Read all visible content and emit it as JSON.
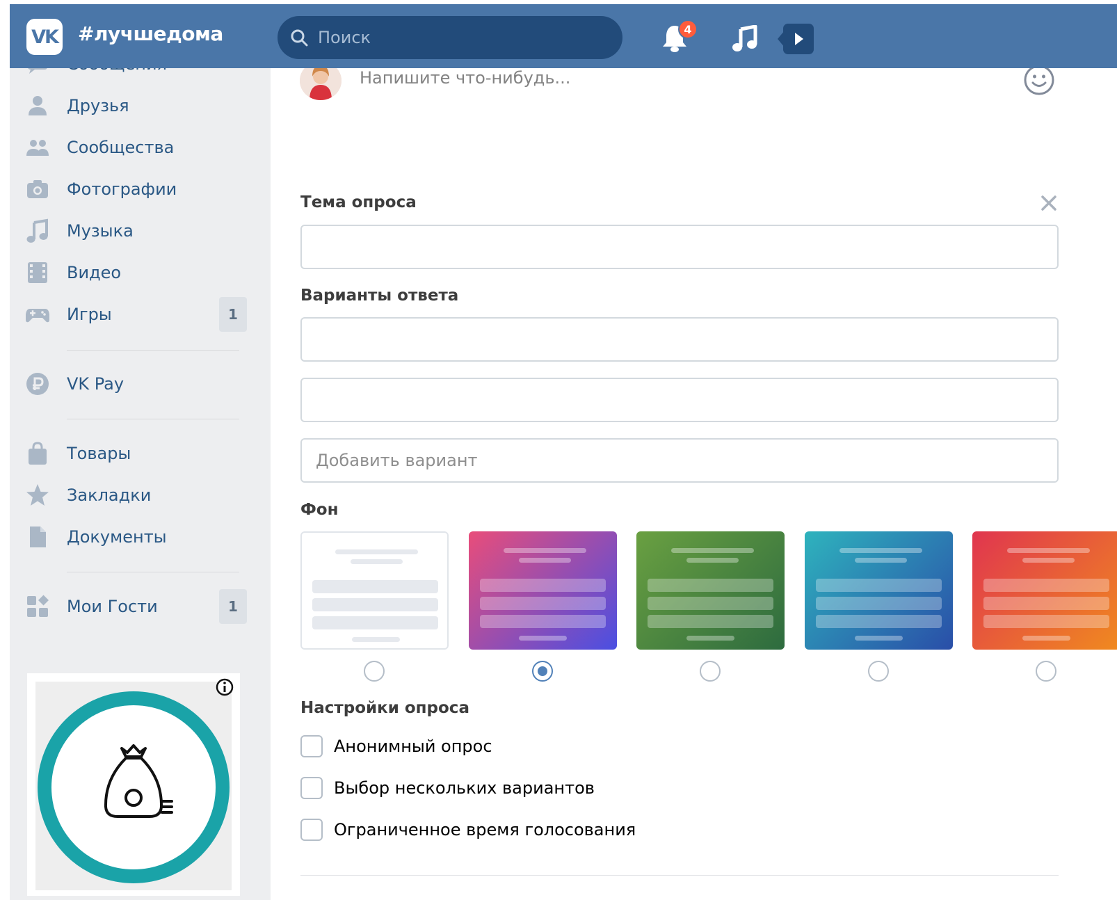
{
  "header": {
    "logo_text": "VK",
    "hashtag": "#лучшедома",
    "search_placeholder": "Поиск",
    "notifications_count": "4"
  },
  "sidebar": {
    "items": [
      {
        "label": "Сообщения",
        "icon": "message-icon"
      },
      {
        "label": "Друзья",
        "icon": "user-icon"
      },
      {
        "label": "Сообщества",
        "icon": "users-icon"
      },
      {
        "label": "Фотографии",
        "icon": "camera-icon"
      },
      {
        "label": "Музыка",
        "icon": "music-icon"
      },
      {
        "label": "Видео",
        "icon": "film-icon"
      },
      {
        "label": "Игры",
        "icon": "gamepad-icon",
        "count": "1"
      },
      {
        "label": "VK Pay",
        "icon": "ruble-icon"
      },
      {
        "label": "Товары",
        "icon": "bag-icon"
      },
      {
        "label": "Закладки",
        "icon": "star-icon"
      },
      {
        "label": "Документы",
        "icon": "document-icon"
      },
      {
        "label": "Мои Гости",
        "icon": "apps-icon",
        "count": "1"
      }
    ]
  },
  "composer": {
    "placeholder": "Напишите что-нибудь..."
  },
  "poll": {
    "topic_label": "Тема опроса",
    "topic_value": "",
    "answers_label": "Варианты ответа",
    "answers": [
      "",
      ""
    ],
    "add_option_placeholder": "Добавить вариант",
    "background_label": "Фон",
    "backgrounds": [
      {
        "name": "white",
        "colors": [
          "#ffffff",
          "#ffffff"
        ],
        "selected": false
      },
      {
        "name": "pink-purple",
        "colors": [
          "#e94d7a",
          "#4a4fe2"
        ],
        "selected": true
      },
      {
        "name": "green",
        "colors": [
          "#6aa041",
          "#2d6b3f"
        ],
        "selected": false
      },
      {
        "name": "teal-blue",
        "colors": [
          "#2eb3bd",
          "#2a4ea8"
        ],
        "selected": false
      },
      {
        "name": "red-orange",
        "colors": [
          "#e0354f",
          "#f08a1f"
        ],
        "selected": false
      }
    ],
    "settings_label": "Настройки опроса",
    "settings": [
      {
        "label": "Анонимный опрос",
        "checked": false
      },
      {
        "label": "Выбор нескольких вариантов",
        "checked": false
      },
      {
        "label": "Ограниченное время голосования",
        "checked": false
      }
    ]
  },
  "colors": {
    "header": "#4a76a8",
    "search": "#224b7a",
    "sidebar_bg": "#edeef0",
    "link": "#2a5885",
    "accent": "#5181b8",
    "badge": "#ff5c3c",
    "ad_ring": "#1aa3a8"
  }
}
